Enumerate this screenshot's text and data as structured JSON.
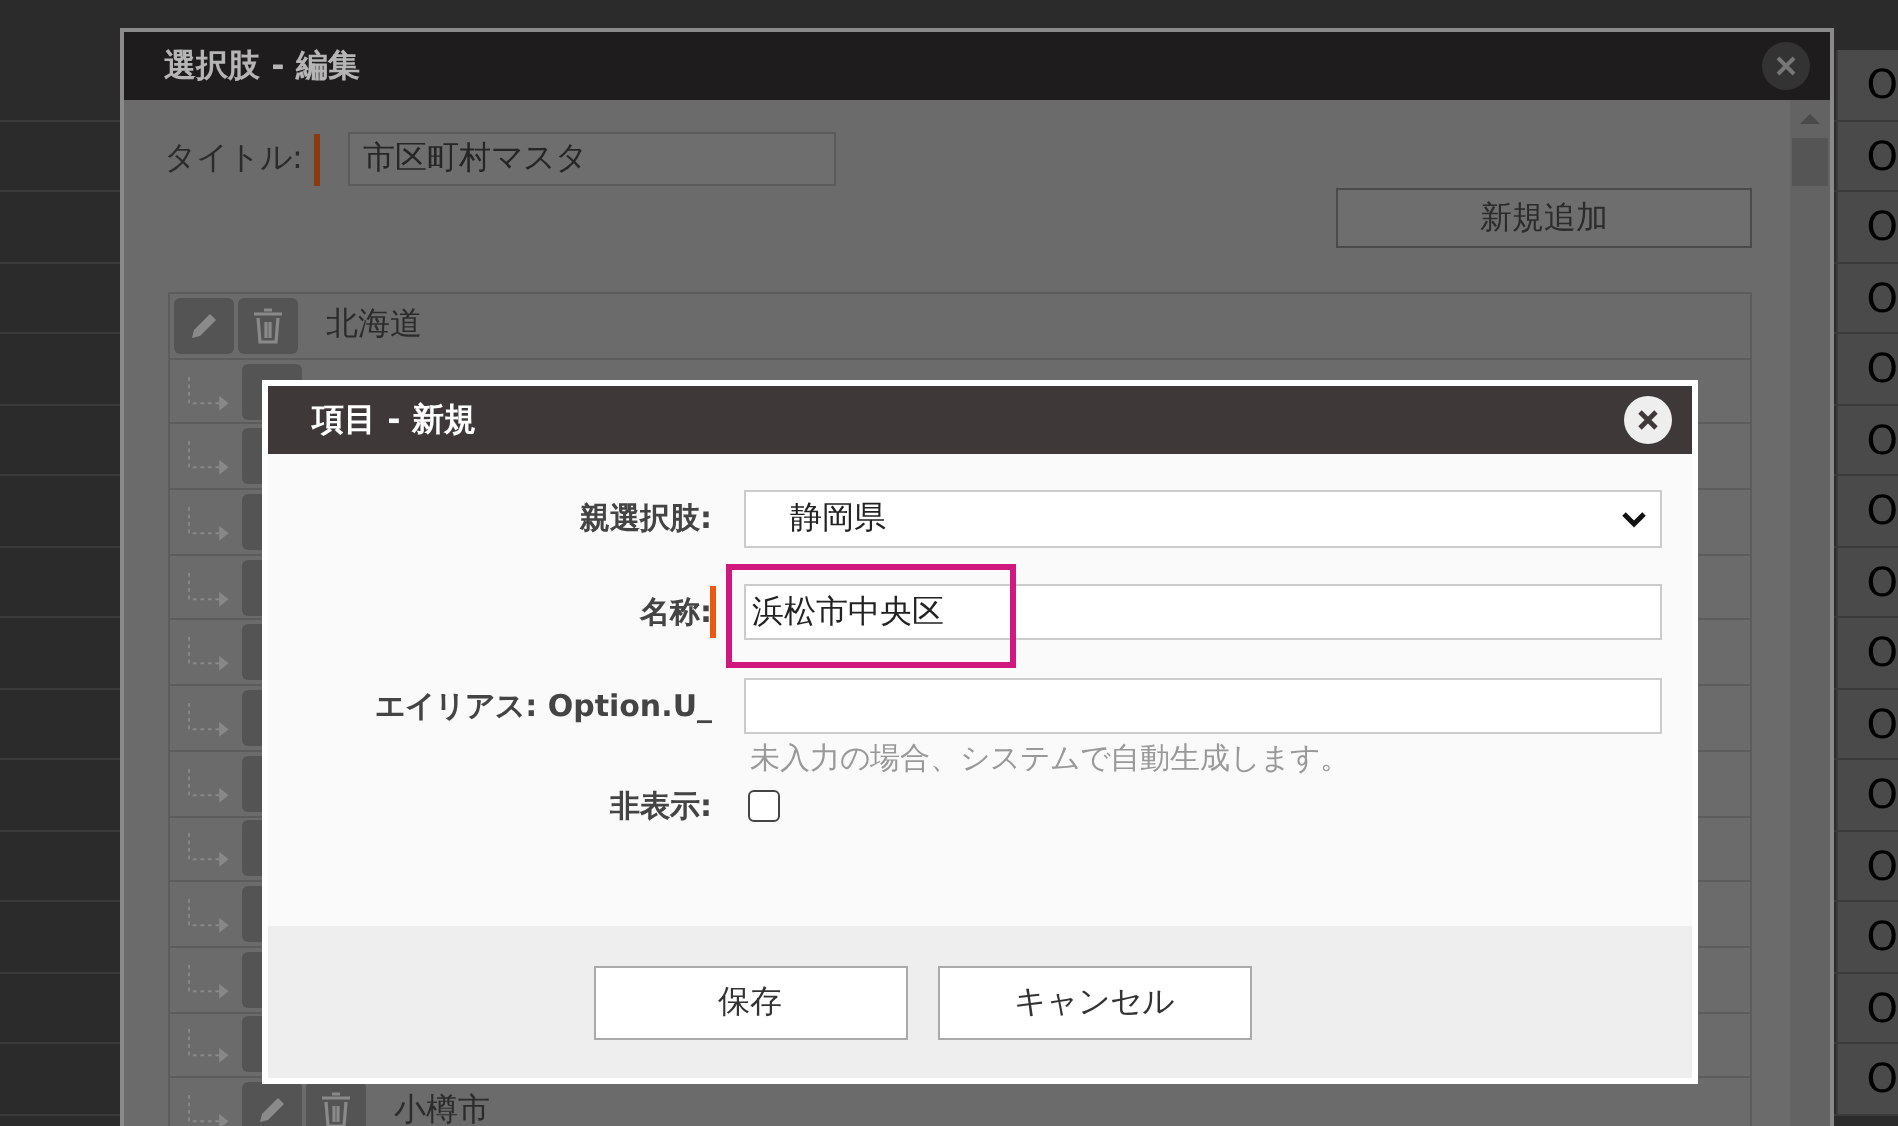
{
  "background_table": {
    "rows": [
      {
        "status": "O"
      },
      {
        "status": "O"
      },
      {
        "status": "O"
      },
      {
        "status": "O"
      },
      {
        "status": "O"
      },
      {
        "status": "O"
      },
      {
        "status": "O"
      },
      {
        "status": "O"
      },
      {
        "status": "O"
      },
      {
        "status": "O"
      },
      {
        "status": "O"
      },
      {
        "status": "O"
      },
      {
        "status": "O"
      },
      {
        "status": "O"
      },
      {
        "status": "O"
      }
    ]
  },
  "outer_dialog": {
    "title": "選択肢 - 編集",
    "title_label": "タイトル:",
    "title_required": true,
    "title_value": "市区町村マスタ",
    "add_button": "新規追加",
    "tree": [
      {
        "kind": "item",
        "label": "北海道",
        "children": [
          {
            "kind": "covered"
          },
          {
            "kind": "covered"
          },
          {
            "kind": "covered"
          },
          {
            "kind": "covered"
          },
          {
            "kind": "covered"
          },
          {
            "kind": "covered"
          },
          {
            "kind": "covered"
          },
          {
            "kind": "covered"
          },
          {
            "kind": "covered"
          },
          {
            "kind": "covered"
          },
          {
            "kind": "covered"
          },
          {
            "kind": "item",
            "label": "小樽市"
          }
        ]
      }
    ]
  },
  "modal": {
    "title": "項目 - 新規",
    "fields": [
      {
        "kind": "select",
        "label": "親選択肢:",
        "value": "静岡県"
      },
      {
        "kind": "text",
        "label": "名称:",
        "value": "浜松市中央区",
        "required": true,
        "highlighted": true
      },
      {
        "kind": "text",
        "label": "エイリアス: Option.U_",
        "hint": "未入力の場合、システムで自動生成します。"
      },
      {
        "kind": "checkbox",
        "label": "非表示:",
        "checked": false
      }
    ],
    "buttons": [
      "保存",
      "キャンセル"
    ]
  }
}
